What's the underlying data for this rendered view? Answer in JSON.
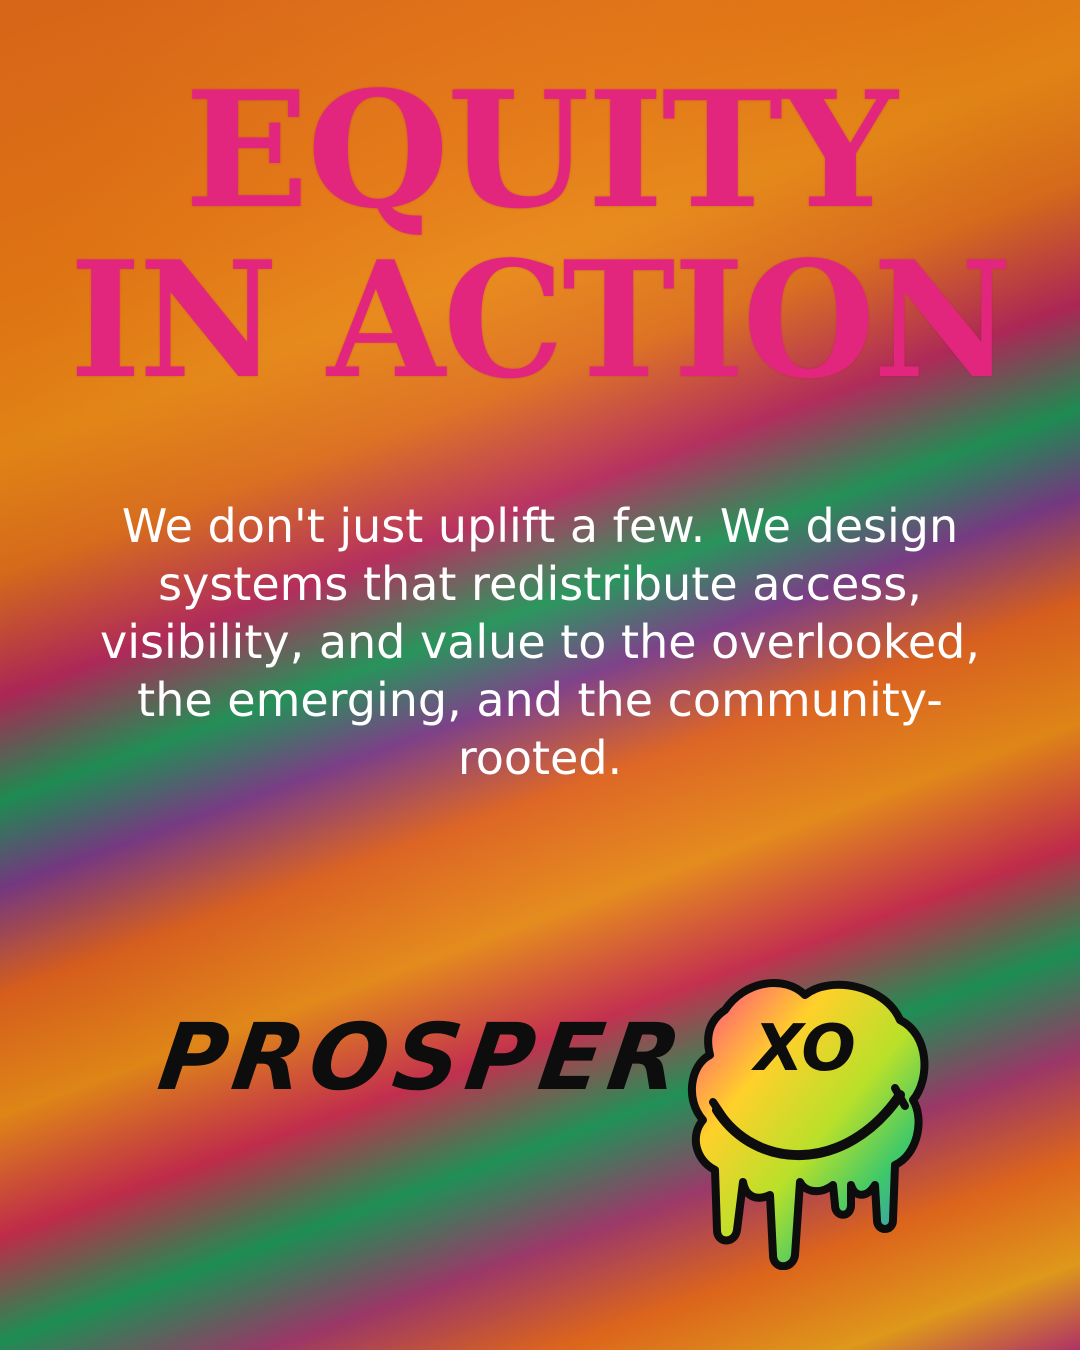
{
  "headline": {
    "line1": "EQUITY",
    "line2": "IN ACTION"
  },
  "body_text": "We don't just uplift a few. We design systems that redistribute access, visibility, and value to the overlooked, the emerging, and the community-rooted.",
  "brand": {
    "wordmark": "PROSPER",
    "logo_text": "XO",
    "logo_icon": "melting-smiley-icon"
  },
  "colors": {
    "headline": "#e2267d",
    "body_text": "#ffffff",
    "wordmark": "#0d0d0d"
  }
}
